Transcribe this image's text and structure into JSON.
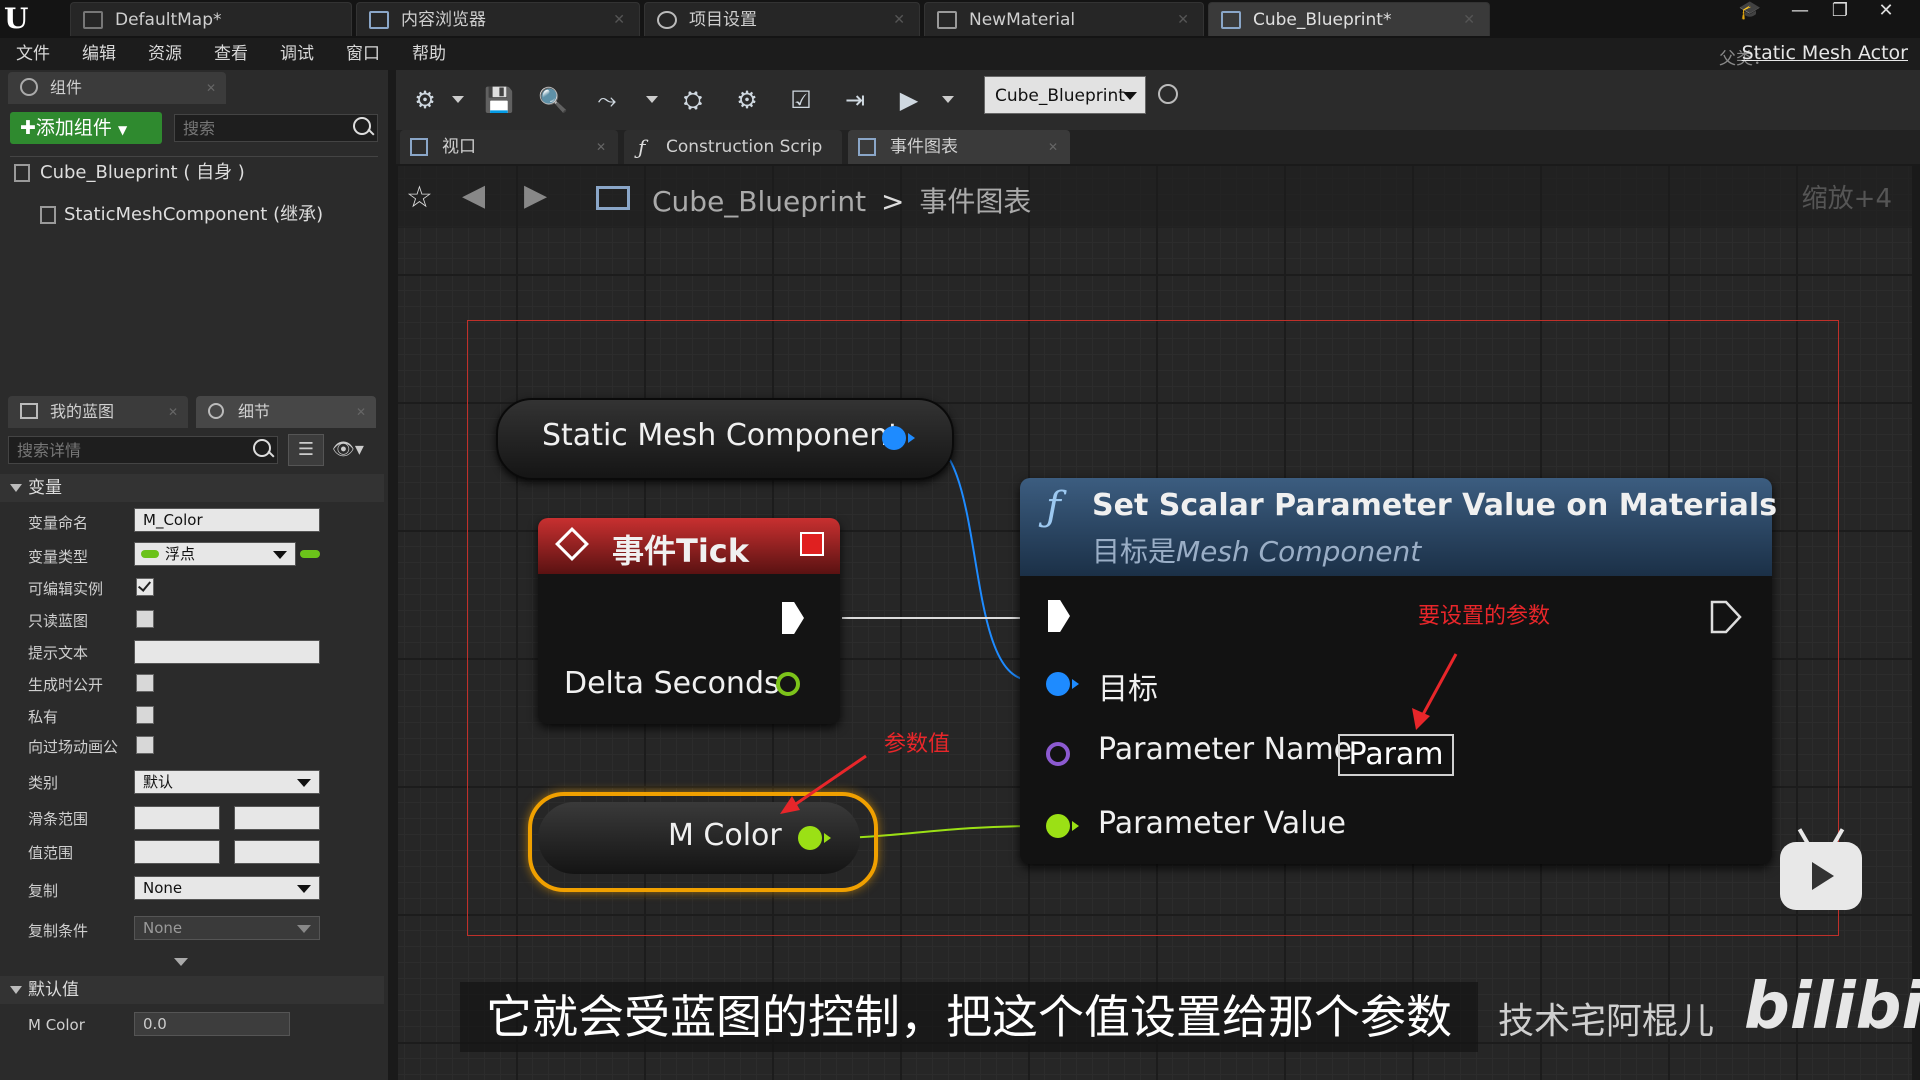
{
  "title_bar": {
    "tabs": [
      {
        "label": "DefaultMap*"
      },
      {
        "label": "内容浏览器"
      },
      {
        "label": "项目设置"
      },
      {
        "label": "NewMaterial"
      },
      {
        "label": "Cube_Blueprint*"
      }
    ],
    "logo": "U"
  },
  "menu": {
    "items": [
      "文件",
      "编辑",
      "资源",
      "查看",
      "调试",
      "窗口",
      "帮助"
    ],
    "parent_label": "父类：",
    "parent_value": "Static Mesh Actor"
  },
  "components_panel": {
    "tab_label": "组件",
    "add_button": "添加组件",
    "search_placeholder": "搜索",
    "items": [
      {
        "label": "Cube_Blueprint ( 自身 )"
      },
      {
        "label": "StaticMeshComponent (继承)"
      }
    ]
  },
  "lower_tabs": {
    "my_blueprint": "我的蓝图",
    "details": "细节",
    "search_placeholder": "搜索详情"
  },
  "details": {
    "section_variable": "变量",
    "var_name_label": "变量命名",
    "var_name_value": "M_Color",
    "var_type_label": "变量类型",
    "var_type_value": "浮点",
    "editable_label": "可编辑实例",
    "readonly_label": "只读蓝图",
    "tooltip_label": "提示文本",
    "expose_spawn_label": "生成时公开",
    "private_label": "私有",
    "cinematic_label": "向过场动画公",
    "category_label": "类别",
    "category_value": "默认",
    "slider_range_label": "滑条范围",
    "value_range_label": "值范围",
    "replication_label": "复制",
    "replication_value": "None",
    "rep_condition_label": "复制条件",
    "rep_condition_value": "None",
    "section_default": "默认值",
    "default_var_label": "M Color",
    "default_var_value": "0.0"
  },
  "toolbar": {
    "blueprint_select": "Cube_Blueprint"
  },
  "editor_tabs": [
    {
      "label": "视口"
    },
    {
      "label": "Construction Scrip"
    },
    {
      "label": "事件图表"
    }
  ],
  "graph": {
    "breadcrumb_root": "Cube_Blueprint",
    "breadcrumb_sep": ">",
    "breadcrumb_leaf": "事件图表",
    "zoom": "缩放+4",
    "nodes": {
      "static_mesh": "Static Mesh Component",
      "event_tick_title": "事件Tick",
      "delta_seconds": "Delta Seconds",
      "m_color": "M Color",
      "set_param_title": "Set Scalar Parameter Value on Materials",
      "set_param_subtitle_prefix": "目标是",
      "set_param_subtitle_target": "Mesh Component",
      "pin_target": "目标",
      "pin_param_name": "Parameter Name",
      "param_name_value": "Param",
      "pin_param_value": "Parameter Value"
    },
    "annotations": {
      "param_to_set": "要设置的参数",
      "param_value": "参数值"
    }
  },
  "overlay": {
    "subtitle": "它就会受蓝图的控制，把这个值设置给那个参数",
    "uploader": "技术宅阿棍儿",
    "site_logo": "bilibili"
  },
  "colors": {
    "annotation_red": "#e8262a",
    "exec_blue_pin": "#1e8bff",
    "float_pin": "#9be015",
    "name_pin": "#8c5ad0"
  }
}
